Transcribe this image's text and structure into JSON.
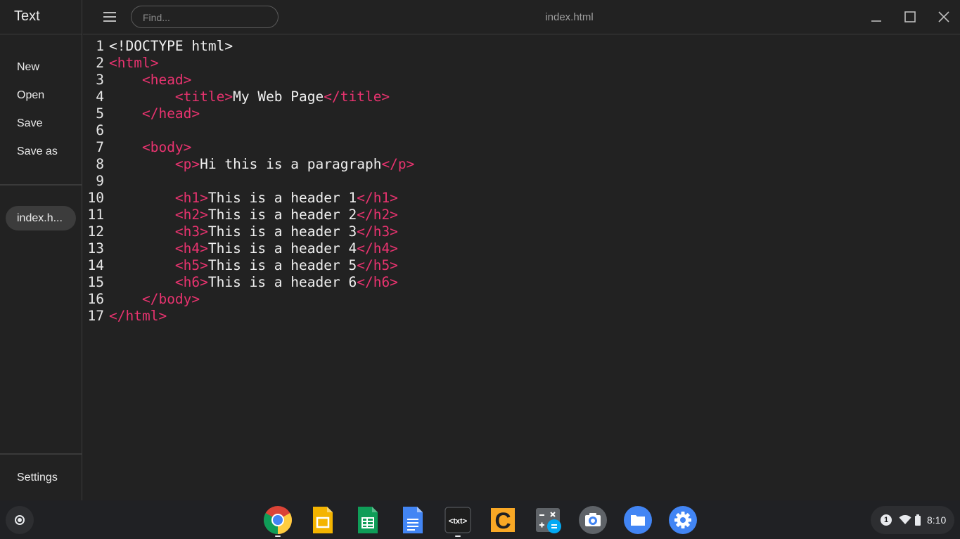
{
  "app": {
    "title": "Text"
  },
  "sidebar": {
    "menu": {
      "new": "New",
      "open": "Open",
      "save": "Save",
      "save_as": "Save as"
    },
    "open_file_tab": "index.h...",
    "settings": "Settings"
  },
  "header": {
    "search_placeholder": "Find...",
    "document_title": "index.html"
  },
  "editor": {
    "colors": {
      "tag": "#e8336f",
      "text": "#f0f0f0",
      "line_number": "#e6e6e6",
      "background": "#222222"
    },
    "lines": [
      {
        "n": "1",
        "indent": 0,
        "parts": [
          [
            "t",
            "<!DOCTYPE html>"
          ]
        ]
      },
      {
        "n": "2",
        "indent": 0,
        "parts": [
          [
            "g",
            "<html>"
          ]
        ]
      },
      {
        "n": "3",
        "indent": 4,
        "parts": [
          [
            "g",
            "<head>"
          ]
        ]
      },
      {
        "n": "4",
        "indent": 8,
        "parts": [
          [
            "g",
            "<title>"
          ],
          [
            "t",
            "My Web Page"
          ],
          [
            "g",
            "</title>"
          ]
        ]
      },
      {
        "n": "5",
        "indent": 4,
        "parts": [
          [
            "g",
            "</head>"
          ]
        ]
      },
      {
        "n": "6",
        "indent": 0,
        "parts": []
      },
      {
        "n": "7",
        "indent": 4,
        "parts": [
          [
            "g",
            "<body>"
          ]
        ]
      },
      {
        "n": "8",
        "indent": 8,
        "parts": [
          [
            "g",
            "<p>"
          ],
          [
            "t",
            "Hi this is a paragraph"
          ],
          [
            "g",
            "</p>"
          ]
        ]
      },
      {
        "n": "9",
        "indent": 0,
        "parts": []
      },
      {
        "n": "10",
        "indent": 8,
        "parts": [
          [
            "g",
            "<h1>"
          ],
          [
            "t",
            "This is a header 1"
          ],
          [
            "g",
            "</h1>"
          ]
        ]
      },
      {
        "n": "11",
        "indent": 8,
        "parts": [
          [
            "g",
            "<h2>"
          ],
          [
            "t",
            "This is a header 2"
          ],
          [
            "g",
            "</h2>"
          ]
        ]
      },
      {
        "n": "12",
        "indent": 8,
        "parts": [
          [
            "g",
            "<h3>"
          ],
          [
            "t",
            "This is a header 3"
          ],
          [
            "g",
            "</h3>"
          ]
        ]
      },
      {
        "n": "13",
        "indent": 8,
        "parts": [
          [
            "g",
            "<h4>"
          ],
          [
            "t",
            "This is a header 4"
          ],
          [
            "g",
            "</h4>"
          ]
        ]
      },
      {
        "n": "14",
        "indent": 8,
        "parts": [
          [
            "g",
            "<h5>"
          ],
          [
            "t",
            "This is a header 5"
          ],
          [
            "g",
            "</h5>"
          ]
        ]
      },
      {
        "n": "15",
        "indent": 8,
        "parts": [
          [
            "g",
            "<h6>"
          ],
          [
            "t",
            "This is a header 6"
          ],
          [
            "g",
            "</h6>"
          ]
        ]
      },
      {
        "n": "16",
        "indent": 4,
        "parts": [
          [
            "g",
            "</body>"
          ]
        ]
      },
      {
        "n": "17",
        "indent": 0,
        "parts": [
          [
            "g",
            "</html>"
          ]
        ]
      }
    ]
  },
  "shelf": {
    "apps": [
      {
        "name": "chrome",
        "icon": "chrome-icon"
      },
      {
        "name": "slides",
        "icon": "slides-icon"
      },
      {
        "name": "sheets",
        "icon": "sheets-icon"
      },
      {
        "name": "docs",
        "icon": "docs-icon"
      },
      {
        "name": "text",
        "icon": "text-editor-icon",
        "label": "<txt>"
      },
      {
        "name": "caret",
        "icon": "caret-editor-icon",
        "label": "C"
      },
      {
        "name": "calculator",
        "icon": "calculator-icon"
      },
      {
        "name": "camera",
        "icon": "camera-icon"
      },
      {
        "name": "files",
        "icon": "files-icon"
      },
      {
        "name": "settings",
        "icon": "settings-icon"
      }
    ],
    "status": {
      "notification_count": "1",
      "time": "8:10"
    }
  }
}
